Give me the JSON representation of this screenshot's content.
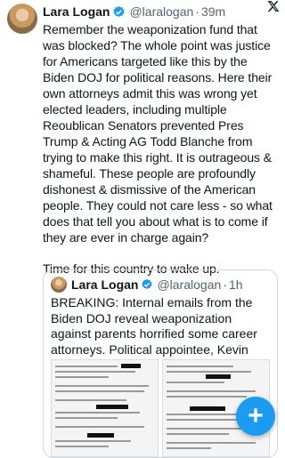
{
  "tweet": {
    "author_name": "Lara Logan",
    "handle": "@laralogan",
    "separator": "·",
    "time": "39m",
    "paragraph1": "Remember the weaponization fund that was blocked? The whole point was justice for Americans targeted like this by the Biden DOJ for political reasons. Here their own attorneys admit this was wrong yet elected leaders, including multiple Reoublican Senators prevented Pres Trump & Acting AG Todd Blanche from trying to make this right. It is outrageous & shameful. These people are profoundly dishonest & dismissive of the American people. They could not care less - so what does that tell you about what is to come if they are ever in charge again?",
    "paragraph2": "Time for this country to wake up."
  },
  "quoted": {
    "author_name": "Lara Logan",
    "handle": "@laralogan",
    "separator": "·",
    "time": "1h",
    "text": "BREAKING: Internal emails from the Biden DOJ reveal weaponization against parents horrified some career attorneys. Political appointee, Kevin Chambers, alerts two career attorneys of the Garland Memo pl..."
  },
  "icons": {
    "platform": "x-logo-icon",
    "verified": "verified-badge-icon",
    "compose": "plus-icon"
  },
  "colors": {
    "accent": "#1d9bf0",
    "secondary_text": "#536471",
    "primary_text": "#0f1419"
  }
}
